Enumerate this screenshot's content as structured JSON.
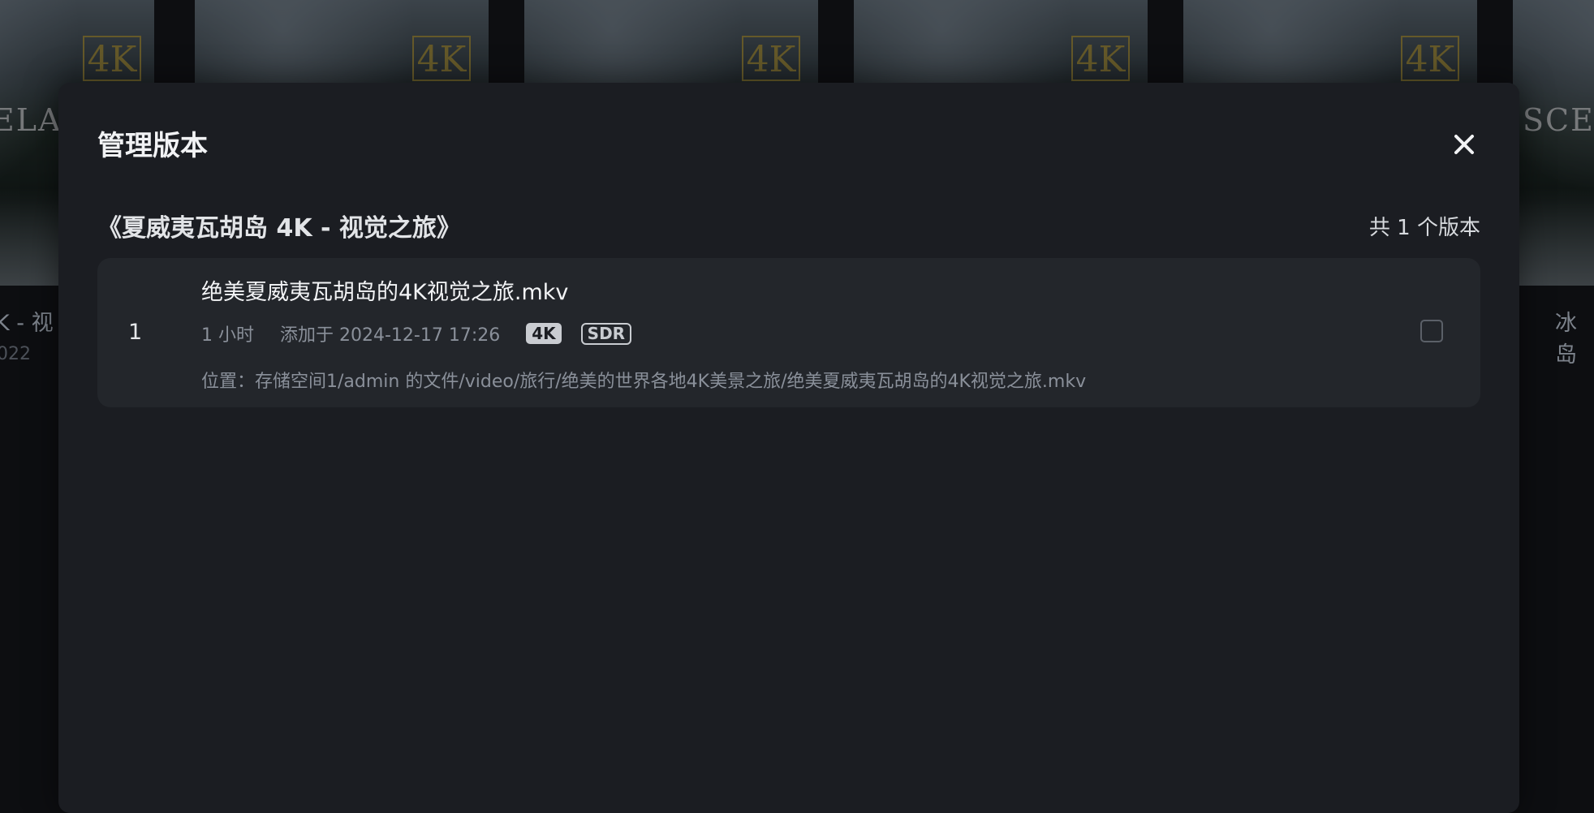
{
  "background": {
    "poster_badge_text": "4K",
    "poster_left_word": "ELAX",
    "poster_right_word": "SCEN",
    "left_caption": "K - 视",
    "left_sub": "022",
    "right_caption": "冰岛"
  },
  "modal": {
    "title": "管理版本",
    "close_icon": "close-icon",
    "movie_title": "《夏威夷瓦胡岛 4K - 视觉之旅》",
    "version_count": "共 1 个版本",
    "versions": [
      {
        "index": "1",
        "file_name": "绝美夏威夷瓦胡岛的4K视觉之旅.mkv",
        "duration": "1 小时",
        "added": "添加于 2024-12-17 17:26",
        "resolution_badge": "4K",
        "dynamic_range_badge": "SDR",
        "location": "位置：存储空间1/admin 的文件/video/旅行/绝美的世界各地4K美景之旅/绝美夏威夷瓦胡岛的4K视觉之旅.mkv",
        "selected": false
      }
    ]
  },
  "colors": {
    "modal_bg": "#1b1d22",
    "card_bg": "#23262b",
    "muted_text": "#8a909a",
    "poster_badge": "#b8a24a"
  }
}
